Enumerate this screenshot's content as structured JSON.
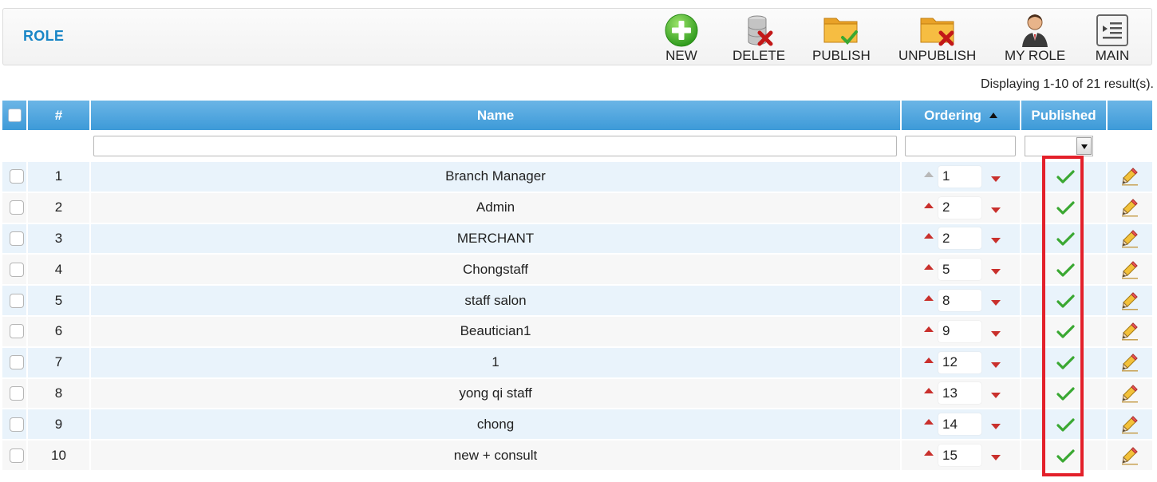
{
  "toolbar": {
    "title": "ROLE",
    "buttons": [
      {
        "label": "NEW",
        "icon": "plus-circle-icon"
      },
      {
        "label": "DELETE",
        "icon": "delete-database-icon"
      },
      {
        "label": "PUBLISH",
        "icon": "folder-check-icon"
      },
      {
        "label": "UNPUBLISH",
        "icon": "folder-x-icon"
      },
      {
        "label": "MY ROLE",
        "icon": "user-avatar-icon"
      },
      {
        "label": "MAIN",
        "icon": "main-menu-icon"
      }
    ]
  },
  "results_text": "Displaying 1-10 of 21 result(s).",
  "table": {
    "headers": {
      "number": "#",
      "name": "Name",
      "ordering": "Ordering",
      "published": "Published"
    },
    "filters": {
      "name": "",
      "ordering": "",
      "published": ""
    },
    "rows": [
      {
        "num": "1",
        "name": "Branch Manager",
        "order": "1",
        "published": true
      },
      {
        "num": "2",
        "name": "Admin",
        "order": "2",
        "published": true
      },
      {
        "num": "3",
        "name": "MERCHANT",
        "order": "2",
        "published": true
      },
      {
        "num": "4",
        "name": "Chongstaff",
        "order": "5",
        "published": true
      },
      {
        "num": "5",
        "name": "staff salon",
        "order": "8",
        "published": true
      },
      {
        "num": "6",
        "name": "Beautician1",
        "order": "9",
        "published": true
      },
      {
        "num": "7",
        "name": "1",
        "order": "12",
        "published": true
      },
      {
        "num": "8",
        "name": "yong qi staff",
        "order": "13",
        "published": true
      },
      {
        "num": "9",
        "name": "chong",
        "order": "14",
        "published": true
      },
      {
        "num": "10",
        "name": "new + consult",
        "order": "15",
        "published": true
      }
    ]
  },
  "colors": {
    "accent": "#1a86c6",
    "header_blue": "#3d9ad8",
    "highlight": "#e3202a",
    "check_green": "#3aa832"
  }
}
